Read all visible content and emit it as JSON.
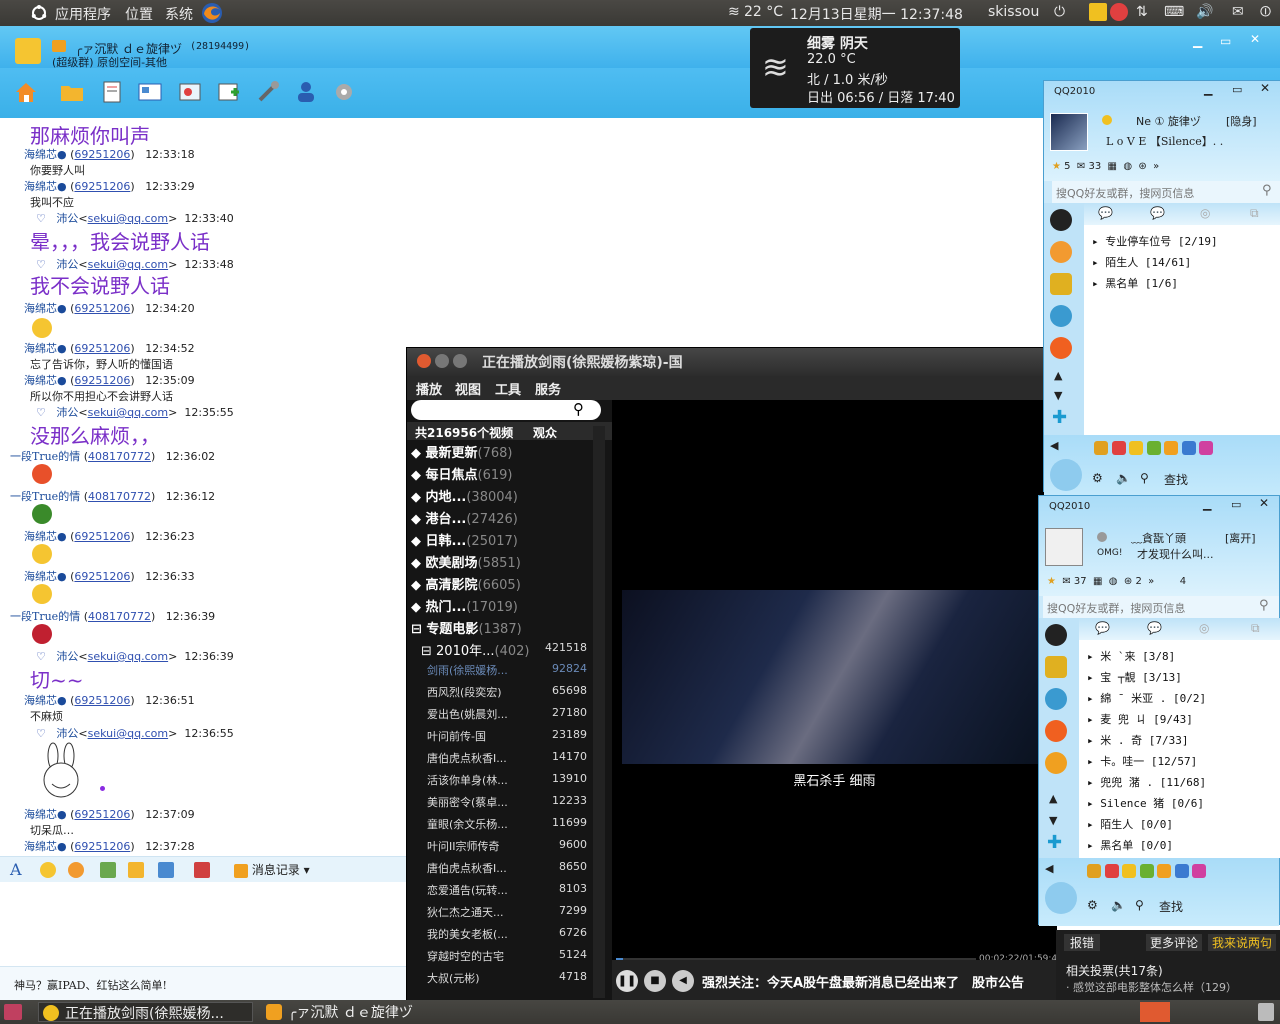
{
  "top_panel": {
    "apps": "应用程序",
    "places": "位置",
    "system": "系统",
    "temp": "22 °C",
    "datetime": "12月13日星期一 12:37:48",
    "user": "skissou"
  },
  "weather": {
    "line1": "细雾 阴天",
    "line2": "22.0 °C",
    "line3": "北 / 1.0 米/秒",
    "line4": "日出 06:56 / 日落 17:40"
  },
  "chat": {
    "title": "╭ァ沉默 ｄｅ旋律ヅ",
    "group_id": "(28194499)",
    "subtitle": "(超级群) 原创空间-其他",
    "messages": [
      {
        "type": "big",
        "text": "那麻烦你叫声"
      },
      {
        "type": "hdr",
        "sender": "海绵芯●",
        "id": "69251206",
        "time": "12:33:18"
      },
      {
        "type": "body",
        "text": "你要野人叫"
      },
      {
        "type": "hdr",
        "sender": "海绵芯●",
        "id": "69251206",
        "time": "12:33:29"
      },
      {
        "type": "body",
        "text": "我叫不应"
      },
      {
        "type": "hdr2",
        "sender": "沛公",
        "email": "sekui@qq.com",
        "time": "12:33:40"
      },
      {
        "type": "big",
        "text": "晕，，，我会说野人话"
      },
      {
        "type": "hdr2",
        "sender": "沛公",
        "email": "sekui@qq.com",
        "time": "12:33:48"
      },
      {
        "type": "big",
        "text": "我不会说野人话"
      },
      {
        "type": "hdr",
        "sender": "海绵芯●",
        "id": "69251206",
        "time": "12:34:20"
      },
      {
        "type": "hdr",
        "sender": "海绵芯●",
        "id": "69251206",
        "time": "12:34:52"
      },
      {
        "type": "body",
        "text": "忘了告诉你，野人听的懂国语"
      },
      {
        "type": "hdr",
        "sender": "海绵芯●",
        "id": "69251206",
        "time": "12:35:09"
      },
      {
        "type": "body",
        "text": "所以你不用担心不会讲野人话"
      },
      {
        "type": "hdr2",
        "sender": "沛公",
        "email": "sekui@qq.com",
        "time": "12:35:55"
      },
      {
        "type": "big",
        "text": "没那么麻烦，，"
      },
      {
        "type": "hdr3",
        "sender": "一段True的情",
        "id": "408170772",
        "time": "12:36:02"
      },
      {
        "type": "hdr3",
        "sender": "一段True的情",
        "id": "408170772",
        "time": "12:36:12"
      },
      {
        "type": "hdr",
        "sender": "海绵芯●",
        "id": "69251206",
        "time": "12:36:23"
      },
      {
        "type": "hdr",
        "sender": "海绵芯●",
        "id": "69251206",
        "time": "12:36:33"
      },
      {
        "type": "hdr3",
        "sender": "一段True的情",
        "id": "408170772",
        "time": "12:36:39"
      },
      {
        "type": "hdr2",
        "sender": "沛公",
        "email": "sekui@qq.com",
        "time": "12:36:39"
      },
      {
        "type": "big",
        "text": "切~~"
      },
      {
        "type": "hdr",
        "sender": "海绵芯●",
        "id": "69251206",
        "time": "12:36:51"
      },
      {
        "type": "body",
        "text": "不麻烦"
      },
      {
        "type": "hdr2",
        "sender": "沛公",
        "email": "sekui@qq.com",
        "time": "12:36:55"
      },
      {
        "type": "hdr",
        "sender": "海绵芯●",
        "id": "69251206",
        "time": "12:37:09"
      },
      {
        "type": "body",
        "text": "切呆瓜…"
      },
      {
        "type": "hdr",
        "sender": "海绵芯●",
        "id": "69251206",
        "time": "12:37:28"
      }
    ],
    "msg_record": "消息记录",
    "ad_text": "神马？赢IPAD、红钻这么简单!"
  },
  "player": {
    "title": "正在播放剑雨(徐熙媛杨紫琼)-国",
    "menu": [
      "播放",
      "视图",
      "工具",
      "服务"
    ],
    "total_label": "共216956个视频",
    "audience_label": "观众",
    "categories": [
      {
        "name": "最新更新",
        "count": "(768)"
      },
      {
        "name": "每日焦点",
        "count": "(619)"
      },
      {
        "name": "内地...",
        "count": "(38004)"
      },
      {
        "name": "港台...",
        "count": "(27426)"
      },
      {
        "name": "日韩...",
        "count": "(25017)"
      },
      {
        "name": "欧美剧场",
        "count": "(5851)"
      },
      {
        "name": "高清影院",
        "count": "(6605)"
      },
      {
        "name": "热门...",
        "count": "(17019)"
      },
      {
        "name": "专题电影",
        "count": "(1387)"
      }
    ],
    "subcat": {
      "name": "2010年...",
      "count": "(402)",
      "views": "421518"
    },
    "videos": [
      {
        "name": "剑雨(徐熙媛杨...",
        "views": "92824"
      },
      {
        "name": "西风烈(段奕宏)",
        "views": "65698"
      },
      {
        "name": "爱出色(姚晨刘...",
        "views": "27180"
      },
      {
        "name": "叶问前传-国",
        "views": "23189"
      },
      {
        "name": "唐伯虎点秋香I...",
        "views": "14170"
      },
      {
        "name": "活该你单身(林...",
        "views": "13910"
      },
      {
        "name": "美丽密令(蔡卓...",
        "views": "12233"
      },
      {
        "name": "童眼(余文乐杨...",
        "views": "11699"
      },
      {
        "name": "叶问II宗师传奇",
        "views": "9600"
      },
      {
        "name": "唐伯虎点秋香I...",
        "views": "8650"
      },
      {
        "name": "恋爱通告(玩转...",
        "views": "8103"
      },
      {
        "name": "狄仁杰之通天...",
        "views": "7299"
      },
      {
        "name": "我的美女老板(...",
        "views": "6726"
      },
      {
        "name": "穿越时空的古宅",
        "views": "5124"
      },
      {
        "name": "大叔(元彬)",
        "views": "4718"
      }
    ],
    "subtitle": "黑石杀手 细雨",
    "time": "00:02:22/01:59:48",
    "ticker": "强烈关注：今天A股午盘最新消息已经出来了　股市公告",
    "progress": 0.02
  },
  "qq1": {
    "title": "QQ2010",
    "nick": "Ne ① 旋律ヅ",
    "status": "[隐身]",
    "sig": "L o V E 【Silence】. .",
    "counts": [
      "5",
      "33"
    ],
    "search": "搜QQ好友或群，搜网页信息",
    "groups": [
      {
        "name": "专业停车位号",
        "count": "[2/19]"
      },
      {
        "name": "陌生人",
        "count": "[14/61]"
      },
      {
        "name": "黑名单",
        "count": "[1/6]"
      }
    ],
    "find": "查找"
  },
  "qq2": {
    "title": "QQ2010",
    "nick": "﹏貪翫丫頭",
    "status": "[离开]",
    "badge": "OMG!",
    "sig": "才发现什么叫...",
    "counts": [
      "37",
      "2",
      "4"
    ],
    "search": "搜QQ好友或群，搜网页信息",
    "groups": [
      {
        "name": "米 `来",
        "count": "[3/8]"
      },
      {
        "name": "  宝 ┬靚",
        "count": "[3/13]"
      },
      {
        "name": "綿 ¯ 米亚 .",
        "count": "[0/2]"
      },
      {
        "name": "麦   兜     ㄐ",
        "count": "[9/43]"
      },
      {
        "name": "  米 . 奇",
        "count": "[7/33]"
      },
      {
        "name": "卡。哇一",
        "count": "[12/57]"
      },
      {
        "name": "兜兜   潴 .",
        "count": "[11/68]"
      },
      {
        "name": "Silence   猪",
        "count": "[0/6]"
      },
      {
        "name": "陌生人",
        "count": "[0/0]"
      },
      {
        "name": "黑名单",
        "count": "[0/0]"
      }
    ],
    "find": "查找"
  },
  "side_panel": {
    "report": "报错",
    "more": "更多评论",
    "comment": "我来说两句",
    "poll": "相关投票(共17条)",
    "poll_item": "· 感觉这部电影整体怎么样（129）"
  },
  "taskbar": {
    "task1": "正在播放剑雨(徐熙媛杨...",
    "task2": "╭ァ沉默 ｄｅ旋律ヅ"
  }
}
